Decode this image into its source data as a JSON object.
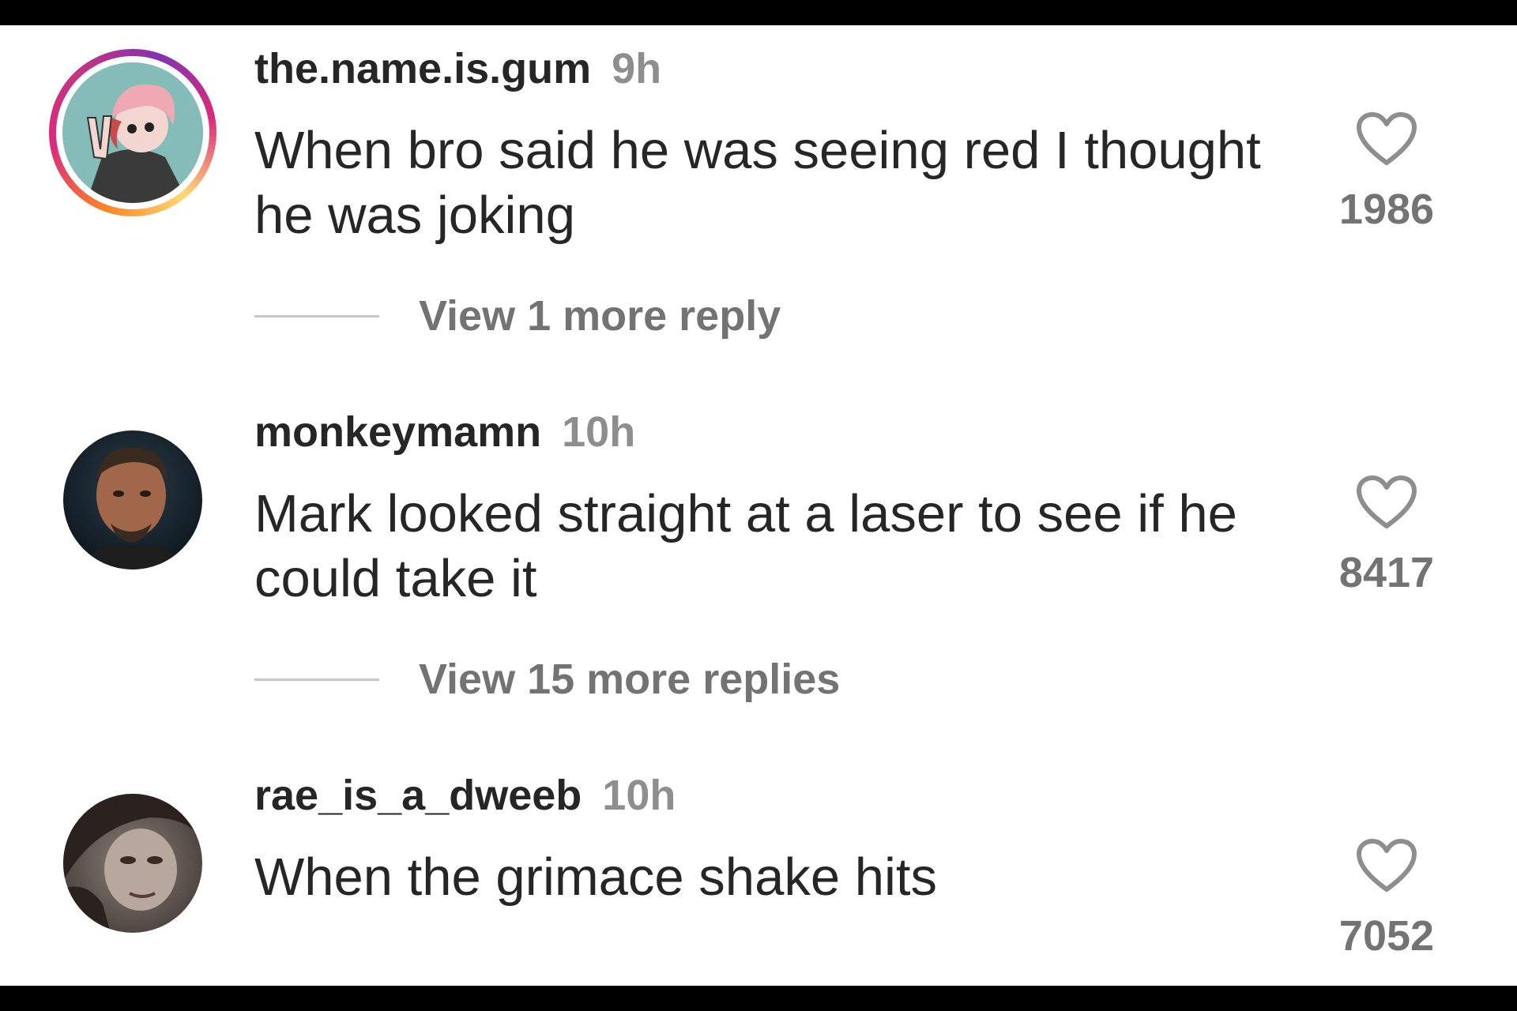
{
  "comments": [
    {
      "username": "the.name.is.gum",
      "time": "9h",
      "text": "When bro said he was seeing red I thought he was joking",
      "likes": "1986",
      "replies_label": "View 1 more reply",
      "avatar_icon": "anime-character-avatar-with-story-ring"
    },
    {
      "username": "monkeymamn",
      "time": "10h",
      "text": "Mark looked straight at a laser to see if he could take it",
      "likes": "8417",
      "replies_label": "View 15 more replies",
      "avatar_icon": "person-photo-avatar"
    },
    {
      "username": "rae_is_a_dweeb",
      "time": "10h",
      "text": "When the grimace shake hits",
      "likes": "7052",
      "avatar_icon": "person-photo-avatar"
    }
  ],
  "icons": {
    "like": "heart-outline-icon"
  },
  "colors": {
    "text": "#262626",
    "secondary": "#8e8e8e",
    "story_ring": "#dd2a7b"
  }
}
